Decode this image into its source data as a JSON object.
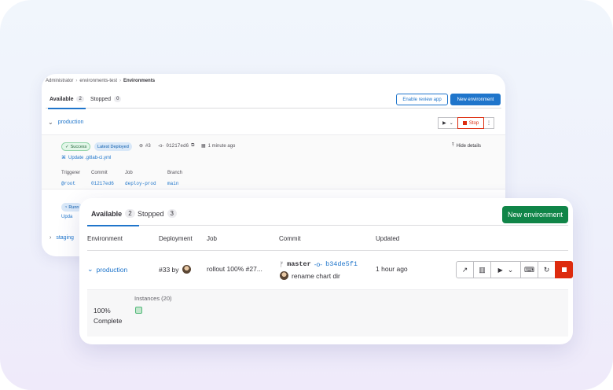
{
  "back": {
    "breadcrumb": [
      "Administrator",
      "environments-test",
      "Environments"
    ],
    "tabs": [
      {
        "label": "Available",
        "count": "2"
      },
      {
        "label": "Stopped",
        "count": "0"
      }
    ],
    "enable_review_app": "Enable review app",
    "new_environment": "New environment",
    "env_name": "production",
    "stop_label": "Stop",
    "badges": {
      "status": "Success",
      "latest": "Latest Deployed"
    },
    "deployment_id": "#3",
    "commit_sha": "01217ed6",
    "time": "1 minute ago",
    "commit_message": "Update .gitlab-ci.yml",
    "hide_details": "Hide details",
    "fields": [
      {
        "label": "Triggerer",
        "value": "@root"
      },
      {
        "label": "Commit",
        "value": "01217ed6"
      },
      {
        "label": "Job",
        "value": "deploy-prod"
      },
      {
        "label": "Branch",
        "value": "main"
      }
    ],
    "running_badge": "Runn",
    "update_partial": "Upda",
    "staging": "staging"
  },
  "front": {
    "tabs": [
      {
        "label": "Available",
        "count": "2"
      },
      {
        "label": "Stopped",
        "count": "3"
      }
    ],
    "new_environment": "New environment",
    "columns": [
      "Environment",
      "Deployment",
      "Job",
      "Commit",
      "Updated"
    ],
    "row": {
      "env": "production",
      "deployment": "#33 by",
      "job": "rollout 100% #27...",
      "branch": "master",
      "sha": "b34de5f1",
      "commit_message": "rename chart dir",
      "updated": "1 hour ago"
    },
    "progress": {
      "percent_label": "100%",
      "status": "Complete",
      "value": 100
    },
    "instances_label": "Instances (20)"
  },
  "colors": {
    "brand_blue": "#1f75cb",
    "success_green": "#108548",
    "danger_red": "#dd2b0e"
  }
}
